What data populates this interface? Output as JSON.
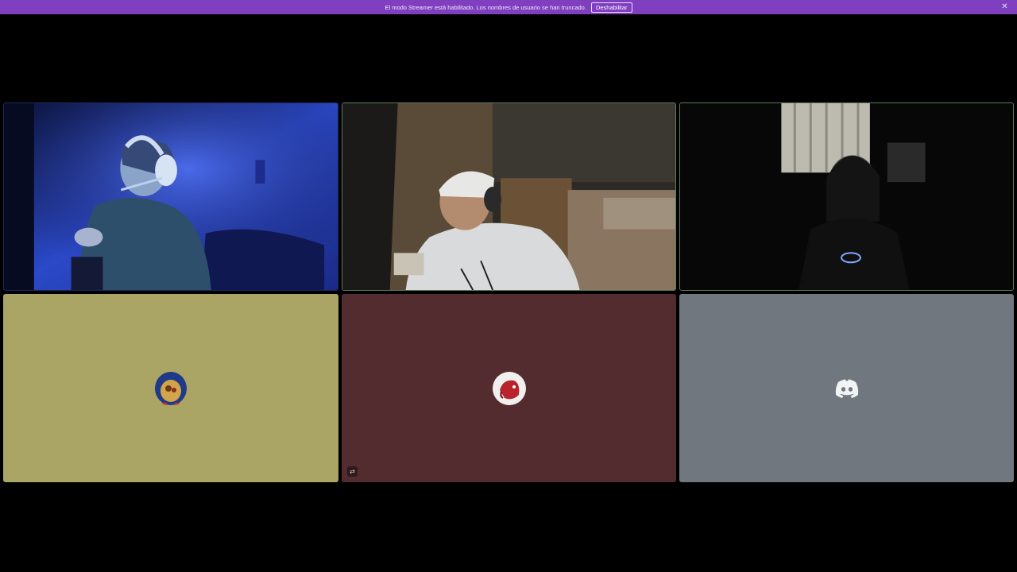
{
  "banner": {
    "message": "El modo Streamer está habilitado. Los nombres de usuario se han truncado.",
    "disable_label": "Deshabilitar",
    "close_icon": "close-icon",
    "color": "#7f3fbf"
  },
  "tiles": [
    {
      "kind": "camera",
      "scene": "blue-room-headset",
      "speaking": false
    },
    {
      "kind": "camera",
      "scene": "beanie-headset",
      "speaking": true
    },
    {
      "kind": "camera",
      "scene": "dark-room-smile",
      "speaking": true
    },
    {
      "kind": "avatar",
      "avatar_icon": "penguin-avatar-icon",
      "background": "#aaa565"
    },
    {
      "kind": "avatar",
      "avatar_icon": "red-creature-avatar-icon",
      "background": "#532c30",
      "badge_icon": "screen-share-icon"
    },
    {
      "kind": "avatar",
      "avatar_icon": "discord-logo-icon",
      "background": "#71777f"
    }
  ]
}
